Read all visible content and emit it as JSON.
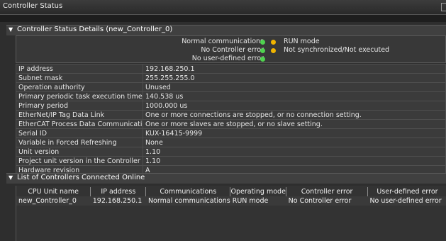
{
  "window": {
    "title": "Controller Status"
  },
  "status_section": {
    "header": "Controller Status Details (new_Controller_0)",
    "indicators": [
      {
        "label": "Normal communications",
        "color": "#4fd34f"
      },
      {
        "label": "No Controller error",
        "color": "#4fd34f"
      },
      {
        "label": "No user-defined error",
        "color": "#4fd34f"
      }
    ],
    "modes": [
      {
        "label": "RUN mode",
        "color": "#f0b400"
      },
      {
        "label": "Not synchronized/Not executed",
        "color": "#f0b400"
      }
    ],
    "properties": [
      {
        "key": "IP address",
        "value": "192.168.250.1"
      },
      {
        "key": "Subnet mask",
        "value": "255.255.255.0"
      },
      {
        "key": "Operation authority",
        "value": "Unused"
      },
      {
        "key": "Primary periodic task execution time",
        "value": "140.538 us"
      },
      {
        "key": "Primary period",
        "value": "1000.000 us"
      },
      {
        "key": "EtherNet/IP Tag Data Link",
        "value": "One or more connections are stopped, or no connection setting."
      },
      {
        "key": "EtherCAT Process Data Communications",
        "value": "One or more slaves are stopped, or no slave setting."
      },
      {
        "key": "Serial ID",
        "value": "KUX-16415-9999"
      },
      {
        "key": "Variable in Forced Refreshing",
        "value": "None"
      },
      {
        "key": "Unit version",
        "value": "1.10"
      },
      {
        "key": "Project unit version in the Controller",
        "value": "1.10"
      },
      {
        "key": "Hardware revision",
        "value": "A"
      }
    ]
  },
  "online_section": {
    "header": "List of Controllers Connected Online",
    "columns": [
      "CPU Unit name",
      "IP address",
      "Communications",
      "Operating mode",
      "Controller error",
      "User-defined error"
    ],
    "rows": [
      [
        "new_Controller_0",
        "192.168.250.1",
        "Normal communications",
        "RUN mode",
        "No Controller error",
        "No user-defined error"
      ]
    ]
  }
}
